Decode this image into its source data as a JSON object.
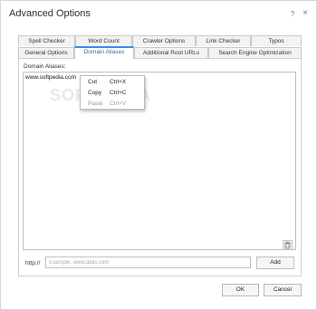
{
  "window": {
    "title": "Advanced Options",
    "help_glyph": "?",
    "close_glyph": "×"
  },
  "tabs_row1": [
    {
      "label": "Spell Checker"
    },
    {
      "label": "Word Count"
    },
    {
      "label": "Crawler Options"
    },
    {
      "label": "Link Checker"
    },
    {
      "label": "Typos"
    }
  ],
  "tabs_row2": [
    {
      "label": "General Options"
    },
    {
      "label": "Domain Aliases",
      "active": true
    },
    {
      "label": "Additional Root URLs"
    },
    {
      "label": "Search Engine Optimization"
    }
  ],
  "aliases": {
    "label": "Domain Aliases:",
    "items": [
      "www.softpedia.com"
    ]
  },
  "context_menu": [
    {
      "label": "Cut",
      "shortcut": "Ctrl+X",
      "enabled": true
    },
    {
      "label": "Copy",
      "shortcut": "Ctrl+C",
      "enabled": true
    },
    {
      "label": "Paste",
      "shortcut": "Ctrl+V",
      "enabled": false
    }
  ],
  "input": {
    "prefix": "http://",
    "placeholder": "Example: www.alias.com",
    "add_label": "Add"
  },
  "footer": {
    "ok_label": "OK",
    "cancel_label": "Cancel"
  },
  "watermark": "SOFTPEDIA",
  "icons": {
    "delete": "trash-icon"
  }
}
